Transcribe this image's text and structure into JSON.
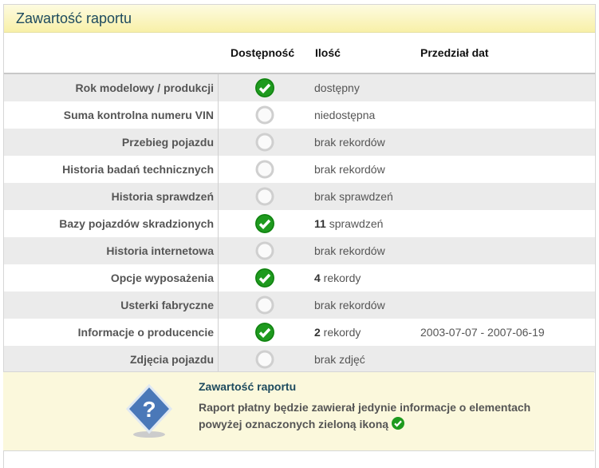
{
  "title": "Zawartość raportu",
  "headers": {
    "availability": "Dostępność",
    "count": "Ilość",
    "date_range": "Przedział dat"
  },
  "rows": [
    {
      "label": "Rok modelowy / produkcji",
      "available": true,
      "num": "",
      "text": "dostępny",
      "dates": ""
    },
    {
      "label": "Suma kontrolna numeru VIN",
      "available": false,
      "num": "",
      "text": "niedostępna",
      "dates": ""
    },
    {
      "label": "Przebieg pojazdu",
      "available": false,
      "num": "",
      "text": "brak rekordów",
      "dates": ""
    },
    {
      "label": "Historia badań technicznych",
      "available": false,
      "num": "",
      "text": "brak rekordów",
      "dates": ""
    },
    {
      "label": "Historia sprawdzeń",
      "available": false,
      "num": "",
      "text": "brak sprawdzeń",
      "dates": ""
    },
    {
      "label": "Bazy pojazdów skradzionych",
      "available": true,
      "num": "11",
      "text": " sprawdzeń",
      "dates": ""
    },
    {
      "label": "Historia internetowa",
      "available": false,
      "num": "",
      "text": "brak rekordów",
      "dates": ""
    },
    {
      "label": "Opcje wyposażenia",
      "available": true,
      "num": "4",
      "text": " rekordy",
      "dates": ""
    },
    {
      "label": "Usterki fabryczne",
      "available": false,
      "num": "",
      "text": "brak rekordów",
      "dates": ""
    },
    {
      "label": "Informacje o producencie",
      "available": true,
      "num": "2",
      "text": " rekordy",
      "dates": "2003-07-07 - 2007-06-19"
    },
    {
      "label": "Zdjęcia pojazdu",
      "available": false,
      "num": "",
      "text": "brak zdjęć",
      "dates": ""
    }
  ],
  "info": {
    "title": "Zawartość raportu",
    "text": "Raport płatny będzie zawierał jedynie informacje o elementach powyżej oznaczonych zieloną ikoną"
  },
  "colors": {
    "green": "#1e9a1e",
    "title": "#1d4a5e"
  }
}
